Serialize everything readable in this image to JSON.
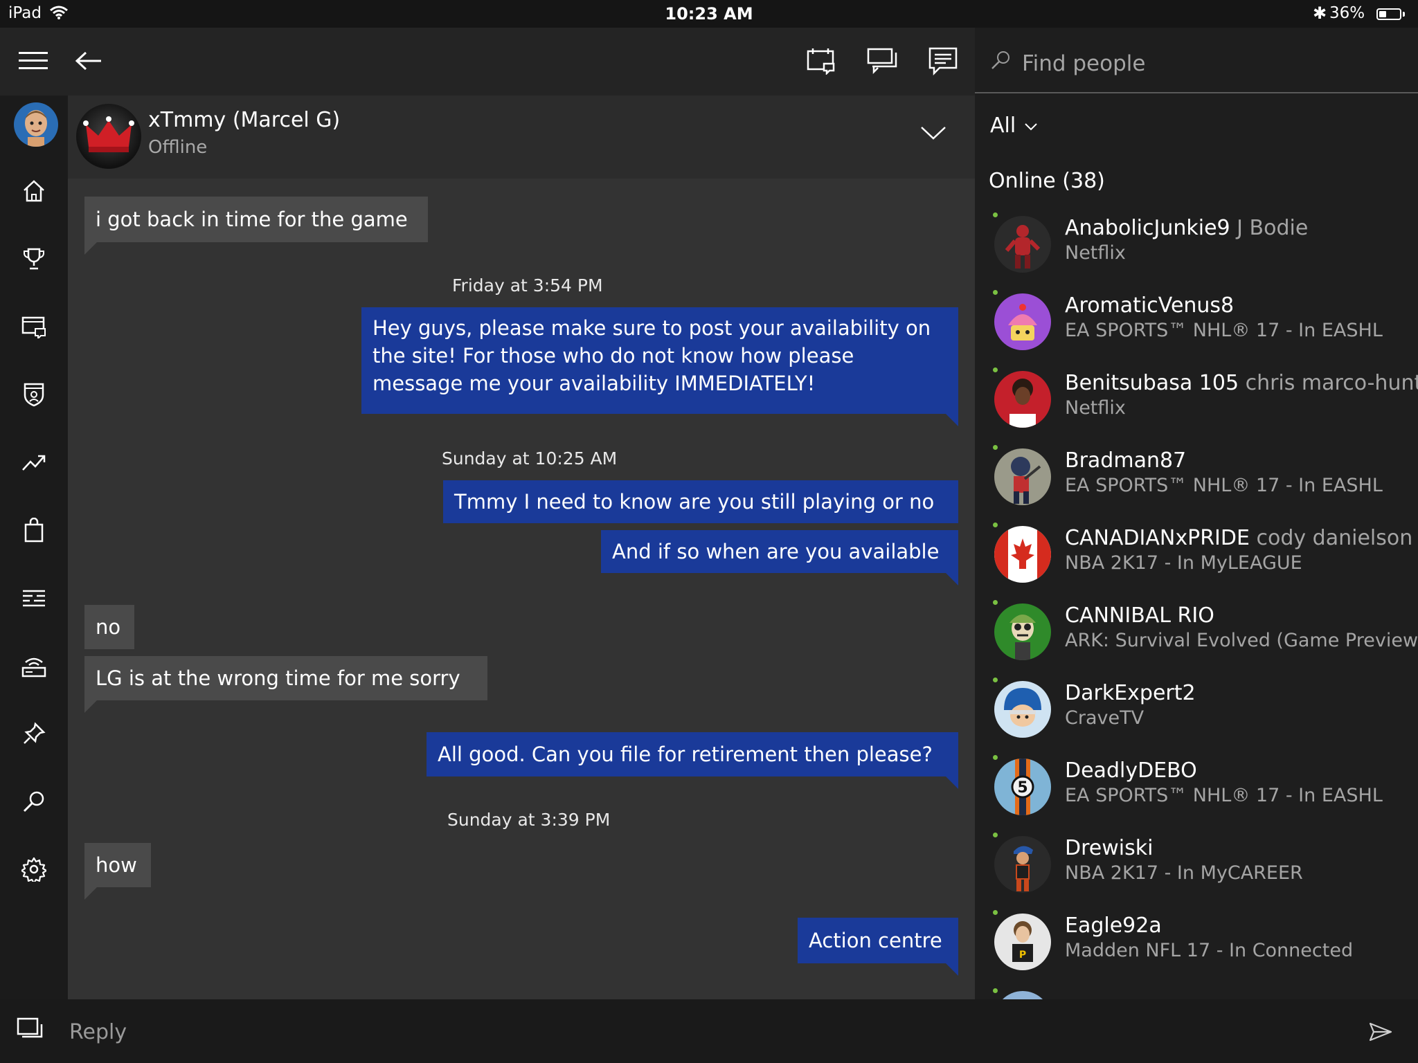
{
  "status_bar": {
    "device": "iPad",
    "time": "10:23 AM",
    "battery": "36%",
    "battery_level": 0.36
  },
  "conversation": {
    "name": "xTmmy (Marcel G)",
    "status": "Offline"
  },
  "messages": [
    {
      "text": "i got back in time for the game",
      "dir": "in"
    },
    {
      "stamp": "Friday at 3:54 PM"
    },
    {
      "text": "Hey guys, please make sure to post your availability on the site! For those who do not know how please message me your availability IMMEDIATELY!",
      "dir": "out"
    },
    {
      "stamp": "Sunday at 10:25 AM"
    },
    {
      "text": "Tmmy I need to know are you still playing or no",
      "dir": "out"
    },
    {
      "text": "And if so when are you available",
      "dir": "out"
    },
    {
      "text": "no",
      "dir": "in"
    },
    {
      "text": "LG is at the wrong time for me sorry",
      "dir": "in"
    },
    {
      "text": "All good. Can you file for retirement then please?",
      "dir": "out"
    },
    {
      "stamp": "Sunday at 3:39 PM"
    },
    {
      "text": "how",
      "dir": "in"
    },
    {
      "text": "Action centre",
      "dir": "out"
    }
  ],
  "reply": {
    "placeholder": "Reply"
  },
  "people": {
    "search_placeholder": "Find people",
    "filter": "All",
    "online_header": "Online (38)",
    "friends": [
      {
        "gamertag": "AnabolicJunkie9",
        "real_name": "J Bodie",
        "activity": "Netflix"
      },
      {
        "gamertag": "AromaticVenus8",
        "real_name": "",
        "activity": "EA SPORTS™ NHL® 17 - In EASHL"
      },
      {
        "gamertag": "Benitsubasa 105",
        "real_name": "chris marco-hunt",
        "activity": "Netflix"
      },
      {
        "gamertag": "Bradman87",
        "real_name": "",
        "activity": "EA SPORTS™ NHL® 17 - In EASHL"
      },
      {
        "gamertag": "CANADIANxPRIDE",
        "real_name": "cody danielson",
        "activity": "NBA 2K17 - In MyLEAGUE"
      },
      {
        "gamertag": "CANNIBAL RIO",
        "real_name": "",
        "activity": "ARK: Survival Evolved (Game Preview)"
      },
      {
        "gamertag": "DarkExpert2",
        "real_name": "",
        "activity": "CraveTV"
      },
      {
        "gamertag": "DeadlyDEBO",
        "real_name": "",
        "activity": "EA SPORTS™ NHL® 17 - In EASHL"
      },
      {
        "gamertag": "Drewiski",
        "real_name": "",
        "activity": "NBA 2K17 - In MyCAREER"
      },
      {
        "gamertag": "Eagle92a",
        "real_name": "",
        "activity": "Madden NFL 17 - In Connected"
      }
    ]
  },
  "colors": {
    "accent": "#1a3a99",
    "online": "#7ac142",
    "incoming": "#4a4a4a"
  }
}
